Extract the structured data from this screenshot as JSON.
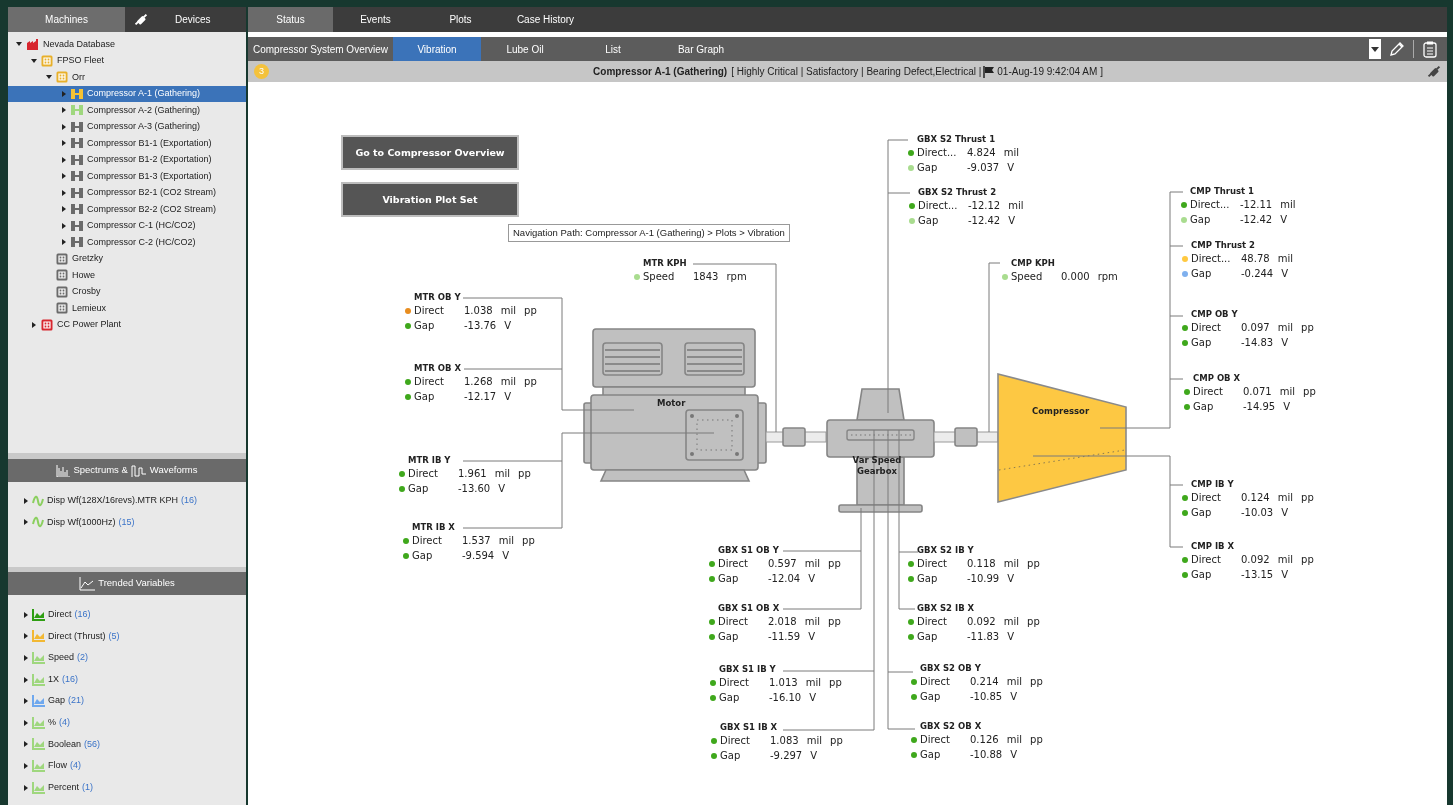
{
  "left_tabs": [
    {
      "label": "Machines",
      "selected": true,
      "kind": "text"
    },
    {
      "label": "Devices",
      "selected": false,
      "kind": "plug"
    }
  ],
  "tree": [
    {
      "label": "Nevada Database",
      "kind": "database",
      "color": "#d7262e",
      "expanded": true,
      "selected": false,
      "children": [
        {
          "label": "FPSO Fleet",
          "kind": "group",
          "color": "#e8b02a",
          "expanded": true,
          "selected": false,
          "children": [
            {
              "label": "Orr",
              "kind": "group",
              "color": "#e8b02a",
              "expanded": true,
              "selected": false,
              "children": [
                {
                  "label": "Compressor A-1 (Gathering)",
                  "kind": "machine",
                  "color": "#f5c233",
                  "expanded": false,
                  "selected": true
                },
                {
                  "label": "Compressor A-2 (Gathering)",
                  "kind": "machine",
                  "color": "#9fd77e",
                  "expanded": false,
                  "selected": false
                },
                {
                  "label": "Compressor A-3 (Gathering)",
                  "kind": "machine",
                  "color": "#6b6b6b",
                  "expanded": false,
                  "selected": false
                },
                {
                  "label": "Compressor B1-1 (Exportation)",
                  "kind": "machine",
                  "color": "#6b6b6b",
                  "expanded": false,
                  "selected": false
                },
                {
                  "label": "Compressor B1-2 (Exportation)",
                  "kind": "machine",
                  "color": "#6b6b6b",
                  "expanded": false,
                  "selected": false
                },
                {
                  "label": "Compressor B1-3 (Exportation)",
                  "kind": "machine",
                  "color": "#6b6b6b",
                  "expanded": false,
                  "selected": false
                },
                {
                  "label": "Compressor B2-1 (CO2 Stream)",
                  "kind": "machine",
                  "color": "#6b6b6b",
                  "expanded": false,
                  "selected": false
                },
                {
                  "label": "Compressor B2-2 (CO2 Stream)",
                  "kind": "machine",
                  "color": "#6b6b6b",
                  "expanded": false,
                  "selected": false
                },
                {
                  "label": "Compressor C-1 (HC/CO2)",
                  "kind": "machine",
                  "color": "#6b6b6b",
                  "expanded": false,
                  "selected": false
                },
                {
                  "label": "Compressor C-2 (HC/CO2)",
                  "kind": "machine",
                  "color": "#6b6b6b",
                  "expanded": false,
                  "selected": false
                }
              ]
            },
            {
              "label": "Gretzky",
              "kind": "group",
              "color": "#6b6b6b",
              "selected": false
            },
            {
              "label": "Howe",
              "kind": "group",
              "color": "#6b6b6b",
              "selected": false
            },
            {
              "label": "Crosby",
              "kind": "group",
              "color": "#6b6b6b",
              "selected": false
            },
            {
              "label": "Lemieux",
              "kind": "group",
              "color": "#6b6b6b",
              "selected": false
            }
          ]
        },
        {
          "label": "CC Power Plant",
          "kind": "group",
          "color": "#d7262e",
          "expanded": false,
          "selected": false
        }
      ]
    }
  ],
  "spectrums_panel": {
    "title_before_icon": "Spectrums &",
    "title_after_icon": "Waveforms",
    "items": [
      {
        "label": "Disp Wf(128X/16revs).MTR KPH",
        "count": "(16)",
        "expanded": false
      },
      {
        "label": "Disp Wf(1000Hz)",
        "count": "(15)",
        "expanded": false
      }
    ]
  },
  "trended_panel": {
    "title": "Trended Variables",
    "items": [
      {
        "label": "Direct",
        "count": "(16)",
        "color": "#2e9e12",
        "expanded": false
      },
      {
        "label": "Direct (Thrust)",
        "count": "(5)",
        "color": "#f2b833",
        "expanded": false
      },
      {
        "label": "Speed",
        "count": "(2)",
        "color": "#9fd77e",
        "expanded": false
      },
      {
        "label": "1X",
        "count": "(16)",
        "color": "#9fd77e",
        "expanded": false
      },
      {
        "label": "Gap",
        "count": "(21)",
        "color": "#6fa8ee",
        "expanded": false
      },
      {
        "label": "%",
        "count": "(4)",
        "color": "#9fd77e",
        "expanded": false
      },
      {
        "label": "Boolean",
        "count": "(56)",
        "color": "#9fd77e",
        "expanded": false
      },
      {
        "label": "Flow",
        "count": "(4)",
        "color": "#9fd77e",
        "expanded": false
      },
      {
        "label": "Percent",
        "count": "(1)",
        "color": "#9fd77e",
        "expanded": false
      }
    ]
  },
  "main_tabs": [
    {
      "label": "Status",
      "selected": true
    },
    {
      "label": "Events",
      "selected": false
    },
    {
      "label": "Plots",
      "selected": false
    },
    {
      "label": "Case History",
      "selected": false
    }
  ],
  "sub_tabs": [
    {
      "label": "Compressor System Overview",
      "selected": false
    },
    {
      "label": "Vibration",
      "selected": true
    },
    {
      "label": "Lube Oil",
      "selected": false
    },
    {
      "label": "List",
      "selected": false
    },
    {
      "label": "Bar Graph",
      "selected": false
    }
  ],
  "header": {
    "badge": "3",
    "machine": "Compressor A-1 (Gathering)",
    "details": "[ Highly Critical |  Satisfactory |  Bearing Defect,Electrical |",
    "timestamp": "01-Aug-19 9:42:04 AM  ]"
  },
  "buttons": [
    "Go to Compressor Overview",
    "Vibration Plot Set"
  ],
  "navigation_path": "Navigation Path: Compressor A-1 (Gathering) > Plots > Vibration",
  "machine_labels": {
    "motor": "Motor",
    "gearbox": "Var Speed Gearbox",
    "compressor": "Compressor"
  },
  "points": [
    {
      "title": "GBX S2 Thrust 1",
      "rows": [
        {
          "label": "Direct...",
          "value": "4.824",
          "unit": "mil",
          "color": "#3fa81c"
        },
        {
          "label": "Gap",
          "value": "-9.037",
          "unit": "V",
          "color": "#a9dc8f"
        }
      ]
    },
    {
      "title": "GBX S2 Thrust 2",
      "rows": [
        {
          "label": "Direct...",
          "value": "-12.12",
          "unit": "mil",
          "color": "#3fa81c"
        },
        {
          "label": "Gap",
          "value": "-12.42",
          "unit": "V",
          "color": "#a9dc8f"
        }
      ]
    },
    {
      "title": "CMP Thrust 1",
      "rows": [
        {
          "label": "Direct...",
          "value": "-12.11",
          "unit": "mil",
          "color": "#3fa81c"
        },
        {
          "label": "Gap",
          "value": "-12.42",
          "unit": "V",
          "color": "#a9dc8f"
        }
      ]
    },
    {
      "title": "MTR KPH",
      "rows": [
        {
          "label": "Speed",
          "value": "1843",
          "unit": "rpm",
          "color": "#a9dc8f"
        }
      ]
    },
    {
      "title": "CMP KPH",
      "rows": [
        {
          "label": "Speed",
          "value": "0.000",
          "unit": "rpm",
          "color": "#a9dc8f"
        }
      ]
    },
    {
      "title": "CMP Thrust 2",
      "rows": [
        {
          "label": "Direct...",
          "value": "48.78",
          "unit": "mil",
          "color": "#ffc940"
        },
        {
          "label": "Gap",
          "value": "-0.244",
          "unit": "V",
          "color": "#7fb0ee"
        }
      ]
    },
    {
      "title": "MTR OB Y",
      "rows": [
        {
          "label": "Direct",
          "value": "1.038",
          "unit": "mil pp",
          "color": "#e88d1f"
        },
        {
          "label": "Gap",
          "value": "-13.76",
          "unit": "V",
          "color": "#3fa81c"
        }
      ]
    },
    {
      "title": "CMP OB Y",
      "rows": [
        {
          "label": "Direct",
          "value": "0.097",
          "unit": "mil pp",
          "color": "#3fa81c"
        },
        {
          "label": "Gap",
          "value": "-14.83",
          "unit": "V",
          "color": "#3fa81c"
        }
      ]
    },
    {
      "title": "MTR OB X",
      "rows": [
        {
          "label": "Direct",
          "value": "1.268",
          "unit": "mil pp",
          "color": "#3fa81c"
        },
        {
          "label": "Gap",
          "value": "-12.17",
          "unit": "V",
          "color": "#3fa81c"
        }
      ]
    },
    {
      "title": "CMP OB X",
      "rows": [
        {
          "label": "Direct",
          "value": "0.071",
          "unit": "mil pp",
          "color": "#3fa81c"
        },
        {
          "label": "Gap",
          "value": "-14.95",
          "unit": "V",
          "color": "#3fa81c"
        }
      ]
    },
    {
      "title": "MTR IB Y",
      "rows": [
        {
          "label": "Direct",
          "value": "1.961",
          "unit": "mil pp",
          "color": "#3fa81c"
        },
        {
          "label": "Gap",
          "value": "-13.60",
          "unit": "V",
          "color": "#3fa81c"
        }
      ]
    },
    {
      "title": "CMP IB Y",
      "rows": [
        {
          "label": "Direct",
          "value": "0.124",
          "unit": "mil pp",
          "color": "#3fa81c"
        },
        {
          "label": "Gap",
          "value": "-10.03",
          "unit": "V",
          "color": "#3fa81c"
        }
      ]
    },
    {
      "title": "MTR IB X",
      "rows": [
        {
          "label": "Direct",
          "value": "1.537",
          "unit": "mil pp",
          "color": "#3fa81c"
        },
        {
          "label": "Gap",
          "value": "-9.594",
          "unit": "V",
          "color": "#3fa81c"
        }
      ]
    },
    {
      "title": "GBX S1 OB Y",
      "rows": [
        {
          "label": "Direct",
          "value": "0.597",
          "unit": "mil pp",
          "color": "#3fa81c"
        },
        {
          "label": "Gap",
          "value": "-12.04",
          "unit": "V",
          "color": "#3fa81c"
        }
      ]
    },
    {
      "title": "GBX S2 IB Y",
      "rows": [
        {
          "label": "Direct",
          "value": "0.118",
          "unit": "mil pp",
          "color": "#3fa81c"
        },
        {
          "label": "Gap",
          "value": "-10.99",
          "unit": "V",
          "color": "#3fa81c"
        }
      ]
    },
    {
      "title": "CMP IB X",
      "rows": [
        {
          "label": "Direct",
          "value": "0.092",
          "unit": "mil pp",
          "color": "#3fa81c"
        },
        {
          "label": "Gap",
          "value": "-13.15",
          "unit": "V",
          "color": "#3fa81c"
        }
      ]
    },
    {
      "title": "GBX S1 OB X",
      "rows": [
        {
          "label": "Direct",
          "value": "2.018",
          "unit": "mil pp",
          "color": "#3fa81c"
        },
        {
          "label": "Gap",
          "value": "-11.59",
          "unit": "V",
          "color": "#3fa81c"
        }
      ]
    },
    {
      "title": "GBX S2 IB X",
      "rows": [
        {
          "label": "Direct",
          "value": "0.092",
          "unit": "mil pp",
          "color": "#3fa81c"
        },
        {
          "label": "Gap",
          "value": "-11.83",
          "unit": "V",
          "color": "#3fa81c"
        }
      ]
    },
    {
      "title": "GBX S1 IB Y",
      "rows": [
        {
          "label": "Direct",
          "value": "1.013",
          "unit": "mil pp",
          "color": "#3fa81c"
        },
        {
          "label": "Gap",
          "value": "-16.10",
          "unit": "V",
          "color": "#3fa81c"
        }
      ]
    },
    {
      "title": "GBX S2 OB Y",
      "rows": [
        {
          "label": "Direct",
          "value": "0.214",
          "unit": "mil pp",
          "color": "#3fa81c"
        },
        {
          "label": "Gap",
          "value": "-10.85",
          "unit": "V",
          "color": "#3fa81c"
        }
      ]
    },
    {
      "title": "GBX S1 IB X",
      "rows": [
        {
          "label": "Direct",
          "value": "1.083",
          "unit": "mil pp",
          "color": "#3fa81c"
        },
        {
          "label": "Gap",
          "value": "-9.297",
          "unit": "V",
          "color": "#3fa81c"
        }
      ]
    },
    {
      "title": "GBX S2 OB X",
      "rows": [
        {
          "label": "Direct",
          "value": "0.126",
          "unit": "mil pp",
          "color": "#3fa81c"
        },
        {
          "label": "Gap",
          "value": "-10.88",
          "unit": "V",
          "color": "#3fa81c"
        }
      ]
    }
  ]
}
